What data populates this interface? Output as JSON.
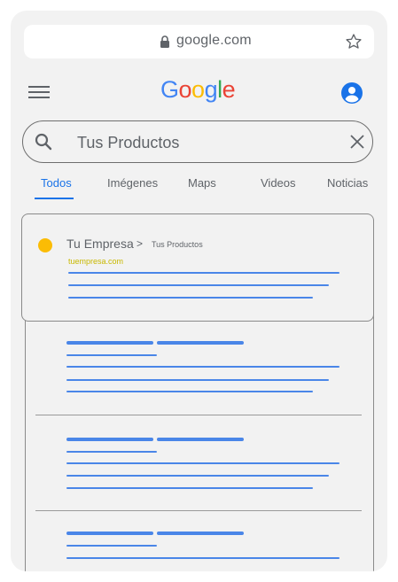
{
  "browser": {
    "url": "google.com"
  },
  "header": {
    "logo_letters": [
      {
        "char": "G",
        "color": "#4285F4"
      },
      {
        "char": "o",
        "color": "#EA4335"
      },
      {
        "char": "o",
        "color": "#FBBC05"
      },
      {
        "char": "g",
        "color": "#4285F4"
      },
      {
        "char": "l",
        "color": "#34A853"
      },
      {
        "char": "e",
        "color": "#EA4335"
      }
    ]
  },
  "search": {
    "query": "Tus Productos"
  },
  "tabs": [
    {
      "label": "Todos",
      "active": true
    },
    {
      "label": "Imégenes",
      "active": false
    },
    {
      "label": "Maps",
      "active": false
    },
    {
      "label": "Videos",
      "active": false
    },
    {
      "label": "Noticias",
      "active": false
    }
  ],
  "featured_result": {
    "business": "Tu Empresa",
    "separator": ">",
    "breadcrumb": "Tus Productos",
    "domain": "tuempresa.com"
  },
  "colors": {
    "accent": "#1a73e8",
    "placeholder_line": "#4a86e8",
    "dot": "#fbbc05",
    "domain": "#c8b800"
  },
  "icons": [
    "lock-icon",
    "star-icon",
    "menu-icon",
    "account-icon",
    "search-icon",
    "close-icon"
  ]
}
